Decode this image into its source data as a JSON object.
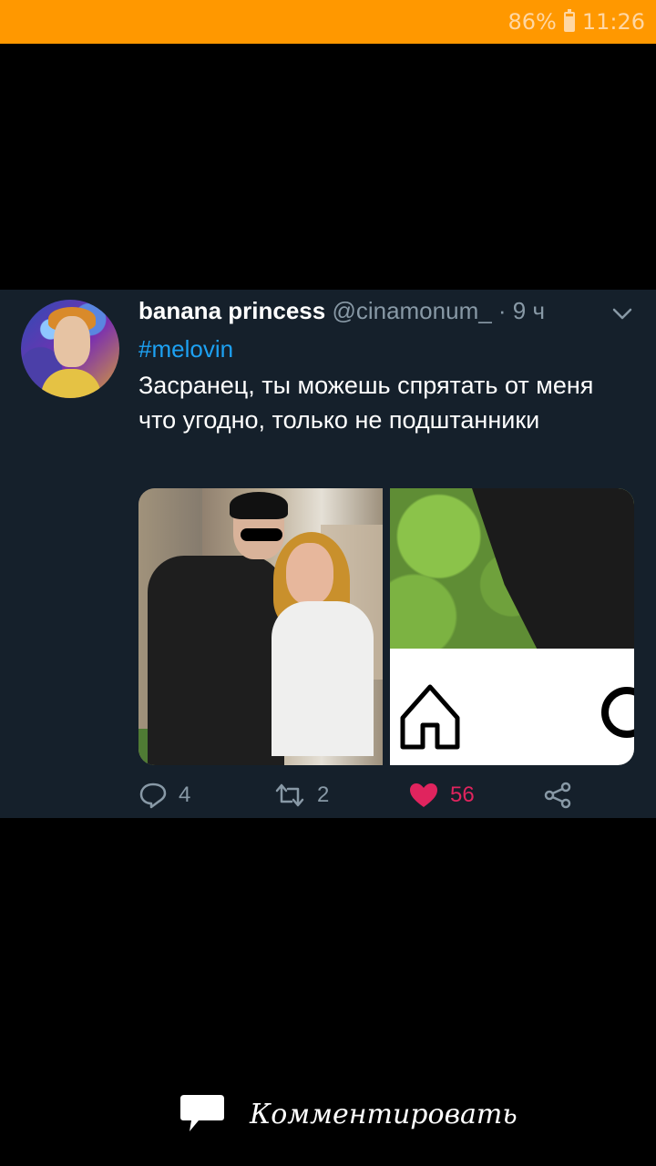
{
  "status_bar": {
    "battery": "86%",
    "time": "11:26",
    "background_color": "#ff9800"
  },
  "tweet": {
    "display_name": "banana princess",
    "handle": "@cinamonum_",
    "time_ago": "· 9 ч",
    "hashtag": "#melovin",
    "text": "Засранец, ты можешь спрятать от меня что угодно, только не подштанники",
    "reply_count": "4",
    "retweet_count": "2",
    "like_count": "56",
    "like_color": "#e0245e",
    "link_color": "#1da1f2",
    "background_color": "#15202b"
  },
  "footer": {
    "comment_label": "Комментировать"
  }
}
